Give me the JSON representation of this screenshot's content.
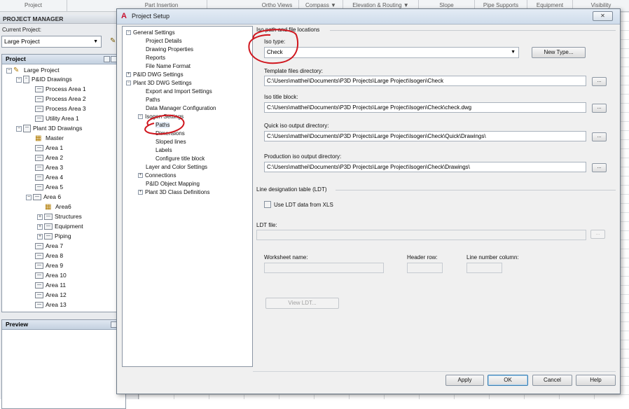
{
  "top_columns": [
    "Project",
    "Part Insertion",
    "Ortho Views",
    "Compass ▼",
    "Elevation & Routing ▼",
    "Slope",
    "Pipe Supports",
    "Equipment",
    "Visibility"
  ],
  "project_manager": {
    "title": "PROJECT MANAGER",
    "current_project_label": "Current Project:",
    "current_project_value": "Large Project",
    "project_section": "Project",
    "preview_section": "Preview",
    "tree": [
      {
        "label": "Large Project",
        "icon": "project-icon"
      },
      {
        "label": "P&ID Drawings",
        "icon": "folder-icon"
      },
      {
        "label": "Process Area 1",
        "icon": "drawing-icon"
      },
      {
        "label": "Process Area 2",
        "icon": "drawing-icon"
      },
      {
        "label": "Process Area 3",
        "icon": "drawing-icon"
      },
      {
        "label": "Utility Area 1",
        "icon": "drawing-icon"
      },
      {
        "label": "Plant 3D Drawings",
        "icon": "folder-icon"
      },
      {
        "label": "Master",
        "icon": "master-drawing-icon"
      },
      {
        "label": "Area 1",
        "icon": "drawing-icon"
      },
      {
        "label": "Area 2",
        "icon": "drawing-icon"
      },
      {
        "label": "Area 3",
        "icon": "drawing-icon"
      },
      {
        "label": "Area 4",
        "icon": "drawing-icon"
      },
      {
        "label": "Area 5",
        "icon": "drawing-icon"
      },
      {
        "label": "Area 6",
        "icon": "folder-icon"
      },
      {
        "label": "Area6",
        "icon": "master-drawing-icon"
      },
      {
        "label": "Structures",
        "icon": "folder-icon"
      },
      {
        "label": "Equipment",
        "icon": "folder-icon"
      },
      {
        "label": "Piping",
        "icon": "folder-icon"
      },
      {
        "label": "Area 7",
        "icon": "drawing-icon"
      },
      {
        "label": "Area 8",
        "icon": "drawing-icon"
      },
      {
        "label": "Area 9",
        "icon": "drawing-icon"
      },
      {
        "label": "Area 10",
        "icon": "drawing-icon"
      },
      {
        "label": "Area 11",
        "icon": "drawing-icon"
      },
      {
        "label": "Area 12",
        "icon": "drawing-icon"
      },
      {
        "label": "Area 13",
        "icon": "drawing-icon"
      }
    ]
  },
  "dialog": {
    "title": "Project Setup",
    "close_label": "✕",
    "nav": [
      {
        "label": "General Settings"
      },
      {
        "label": "Project Details"
      },
      {
        "label": "Drawing Properties"
      },
      {
        "label": "Reports"
      },
      {
        "label": "File Name Format"
      },
      {
        "label": "P&ID DWG Settings"
      },
      {
        "label": "Plant 3D DWG Settings"
      },
      {
        "label": "Export and Import Settings"
      },
      {
        "label": "Paths"
      },
      {
        "label": "Data Manager Configuration"
      },
      {
        "label": "Isogen Settings"
      },
      {
        "label": "Paths"
      },
      {
        "label": "Dimensions"
      },
      {
        "label": "Sloped lines"
      },
      {
        "label": "Labels"
      },
      {
        "label": "Configure title block"
      },
      {
        "label": "Layer and Color Settings"
      },
      {
        "label": "Connections"
      },
      {
        "label": "P&ID Object Mapping"
      },
      {
        "label": "Plant 3D Class Definitions"
      }
    ],
    "iso_group_label": "Iso path and file locations",
    "iso_type_label": "Iso type:",
    "iso_type_value": "Check",
    "new_type_button": "New Type...",
    "template_label": "Template files directory:",
    "template_value": "C:\\Users\\matthei\\Documents\\P3D Projects\\Large Project\\Isogen\\Check",
    "title_block_label": "Iso title block:",
    "title_block_value": "C:\\Users\\matthei\\Documents\\P3D Projects\\Large Project\\Isogen\\Check\\check.dwg",
    "quick_label": "Quick iso output directory:",
    "quick_value": "C:\\Users\\matthei\\Documents\\P3D Projects\\Large Project\\Isogen\\Check\\Quick\\Drawings\\",
    "production_label": "Production iso output directory:",
    "production_value": "C:\\Users\\matthei\\Documents\\P3D Projects\\Large Project\\Isogen\\Check\\Drawings\\",
    "browse_label": "...",
    "ldt_group_label": "Line designation table (LDT)",
    "use_ldt_label": "Use LDT data from XLS",
    "ldt_file_label": "LDT file:",
    "worksheet_label": "Worksheet name:",
    "header_row_label": "Header row:",
    "line_number_label": "Line number column:",
    "view_ldt_button": "View LDT...",
    "apply_button": "Apply",
    "ok_button": "OK",
    "cancel_button": "Cancel",
    "help_button": "Help"
  },
  "colors": {
    "annotation_red": "#d0161e",
    "dialog_bg": "#f0f0f0",
    "brand_red": "#c8102e"
  }
}
